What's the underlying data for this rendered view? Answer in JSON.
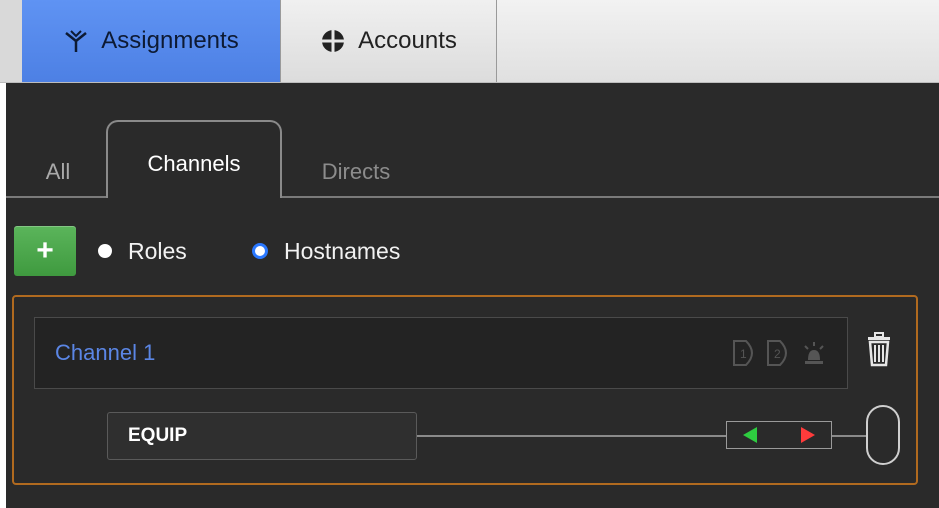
{
  "top_tabs": [
    {
      "label": "Assignments",
      "icon": "assignments-icon",
      "active": true
    },
    {
      "label": "Accounts",
      "icon": "accounts-icon",
      "active": false
    }
  ],
  "sub_tabs": [
    {
      "label": "All",
      "active": false
    },
    {
      "label": "Channels",
      "active": true
    },
    {
      "label": "Directs",
      "active": false
    }
  ],
  "add_button": {
    "label": "+"
  },
  "mode_options": [
    {
      "label": "Roles",
      "selected": false
    },
    {
      "label": "Hostnames",
      "selected": true
    }
  ],
  "channel": {
    "name": "Channel 1",
    "status_icons": [
      "key-1-icon",
      "key-2-icon",
      "alarm-light-icon"
    ]
  },
  "assignment": {
    "label": "EQUIP"
  },
  "colors": {
    "accent_blue": "#4d80e4",
    "add_green": "#3f9a3f",
    "box_border": "#b16a1f",
    "channel_text": "#5b86e5",
    "arrow_left": "#2ecc40",
    "arrow_right": "#ff3b3b"
  }
}
